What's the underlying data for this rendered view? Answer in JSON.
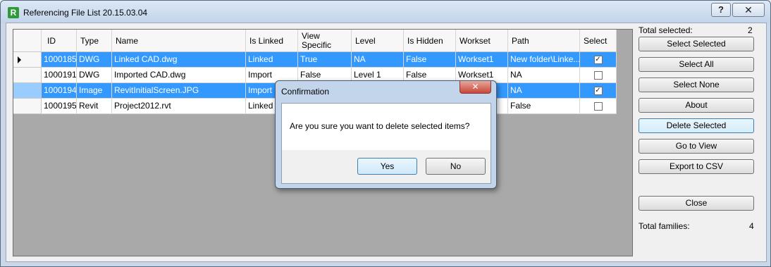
{
  "window": {
    "title": "Referencing File List 20.15.03.04",
    "help_glyph": "?",
    "close_glyph": "✕",
    "app_icon_glyph": "R"
  },
  "grid": {
    "columns": [
      "ID",
      "Type",
      "Name",
      "Is Linked",
      "View Specific",
      "Level",
      "Is Hidden",
      "Workset",
      "Path",
      "Select"
    ],
    "rows": [
      {
        "id": "1000185",
        "type": "DWG",
        "name": "Linked CAD.dwg",
        "is_linked": "Linked",
        "view_specific": "True",
        "level": "NA",
        "is_hidden": "False",
        "workset": "Workset1",
        "path": "New folder\\Linke...",
        "checked": true,
        "state": "selected",
        "current": true
      },
      {
        "id": "1000191",
        "type": "DWG",
        "name": "Imported CAD.dwg",
        "is_linked": "Import",
        "view_specific": "False",
        "level": "Level 1",
        "is_hidden": "False",
        "workset": "Workset1",
        "path": "NA",
        "checked": false,
        "state": "normal",
        "current": false
      },
      {
        "id": "1000194",
        "type": "Image",
        "name": "RevitInitialScreen.JPG",
        "is_linked": "Import",
        "view_specific": "",
        "level": "",
        "is_hidden": "",
        "workset": "",
        "path": "NA",
        "checked": true,
        "state": "selected",
        "current": false
      },
      {
        "id": "1000195",
        "type": "Revit",
        "name": "Project2012.rvt",
        "is_linked": "Linked",
        "view_specific": "",
        "level": "",
        "is_hidden": "",
        "workset": "",
        "path": "False",
        "checked": false,
        "state": "normal",
        "current": false
      }
    ]
  },
  "sidebar": {
    "total_selected_label": "Total selected:",
    "total_selected_value": "2",
    "buttons": {
      "select_selected": "Select Selected",
      "select_all": "Select All",
      "select_none": "Select None",
      "about": "About",
      "delete_selected": "Delete Selected",
      "go_to_view": "Go to View",
      "export_csv": "Export to CSV",
      "close": "Close"
    },
    "total_families_label": "Total families:",
    "total_families_value": "4"
  },
  "dialog": {
    "title": "Confirmation",
    "message": "Are you sure you want to delete selected items?",
    "yes": "Yes",
    "no": "No",
    "close_glyph": "✕"
  },
  "check_glyph": "✓"
}
